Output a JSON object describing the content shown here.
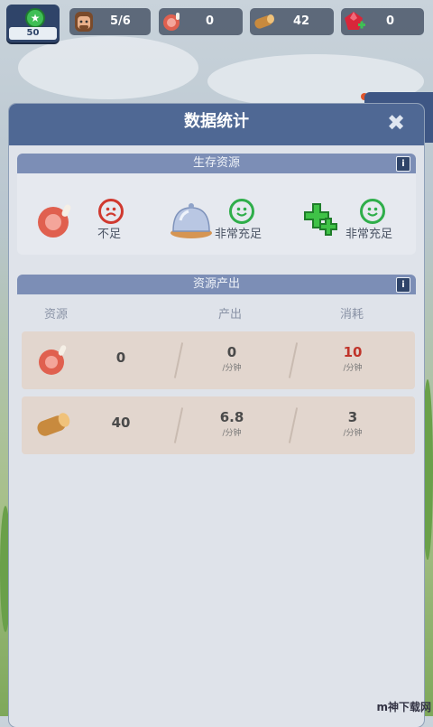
{
  "topbar": {
    "level": "50",
    "population": "5/6",
    "meat": "0",
    "wood": "42",
    "gems": "0"
  },
  "panel": {
    "title": "数据统计",
    "survival": {
      "title": "生存资源",
      "info": "i",
      "items": [
        {
          "icon": "meat-icon",
          "status": "不足",
          "mood": "sad",
          "color": "#d0392f"
        },
        {
          "icon": "food-cloche-icon",
          "status": "非常充足",
          "mood": "happy",
          "color": "#2fae4a"
        },
        {
          "icon": "health-cross-icon",
          "status": "非常充足",
          "mood": "happy",
          "color": "#2fae4a"
        }
      ]
    },
    "production": {
      "title": "资源产出",
      "info": "i",
      "columns": [
        "资源",
        "产出",
        "消耗"
      ],
      "rows": [
        {
          "icon": "meat-icon",
          "amount": "0",
          "output": "0",
          "output_unit": "/分钟",
          "consume": "10",
          "consume_unit": "/分钟",
          "consume_color": "#c0342a"
        },
        {
          "icon": "wood-log-icon",
          "amount": "40",
          "output": "6.8",
          "output_unit": "/分钟",
          "consume": "3",
          "consume_unit": "/分钟",
          "consume_color": "#4a4a4a"
        }
      ]
    }
  },
  "watermark": "m神下载网"
}
